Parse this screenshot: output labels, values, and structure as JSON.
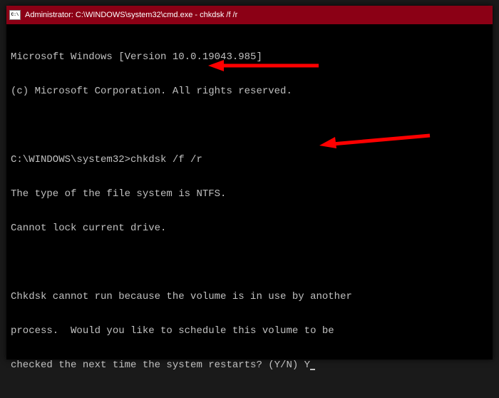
{
  "titlebar": {
    "icon_label": "C:\\",
    "title": "Administrator: C:\\WINDOWS\\system32\\cmd.exe - chkdsk  /f /r"
  },
  "terminal": {
    "line1": "Microsoft Windows [Version 10.0.19043.985]",
    "line2": "(c) Microsoft Corporation. All rights reserved.",
    "prompt": "C:\\WINDOWS\\system32>",
    "command": "chkdsk /f /r",
    "line4": "The type of the file system is NTFS.",
    "line5": "Cannot lock current drive.",
    "line6": "Chkdsk cannot run because the volume is in use by another",
    "line7": "process.  Would you like to schedule this volume to be",
    "line8": "checked the next time the system restarts? (Y/N) ",
    "input_response": "Y"
  },
  "colors": {
    "titlebar_bg": "#8b0015",
    "terminal_bg": "#000000",
    "terminal_fg": "#c0c0c0",
    "arrow": "#ff0000"
  }
}
